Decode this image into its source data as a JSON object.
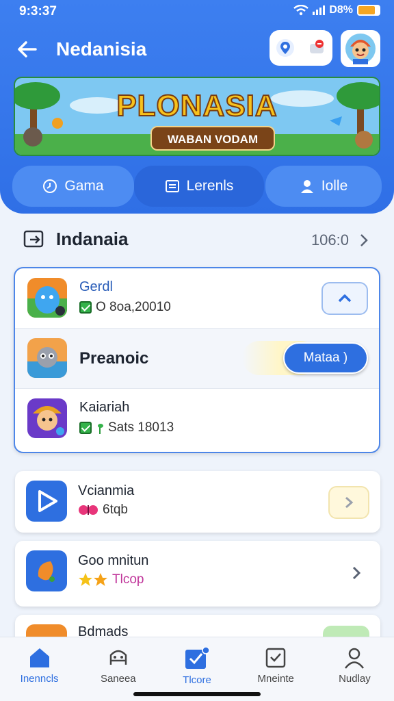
{
  "status": {
    "time": "9:3:37",
    "battery": "D8%"
  },
  "header": {
    "title": "Nedanisia"
  },
  "banner": {
    "title": "PLONASIA",
    "subtitle": "WABAN VODAM"
  },
  "tabs": [
    {
      "label": "Gama"
    },
    {
      "label": "Lerenls"
    },
    {
      "label": "Iolle"
    }
  ],
  "section": {
    "label": "Indanaia",
    "value": "106:0"
  },
  "list": [
    {
      "name": "Gerdl",
      "meta": "O 8oa,20010",
      "button": ""
    },
    {
      "name": "Preanoic",
      "meta": "",
      "button": "Mataa )"
    },
    {
      "name": "Kaiariah",
      "meta": "Sats 18013",
      "button": ""
    }
  ],
  "cards": [
    {
      "name": "Vcianmia",
      "meta": "6tqb"
    },
    {
      "name": "Goo mnitun",
      "meta": "Tlcop"
    },
    {
      "name": "Bdmads",
      "meta": ""
    }
  ],
  "bottom_nav": [
    {
      "label": "Inenncls",
      "active": false
    },
    {
      "label": "Saneea",
      "active": false
    },
    {
      "label": "Tlcore",
      "active": true
    },
    {
      "label": "Mneinte",
      "active": false
    },
    {
      "label": "Nudlay",
      "active": false
    }
  ],
  "colors": {
    "primary": "#2e6fe0",
    "header": "#3d7ff0",
    "background": "#eef3fb"
  }
}
